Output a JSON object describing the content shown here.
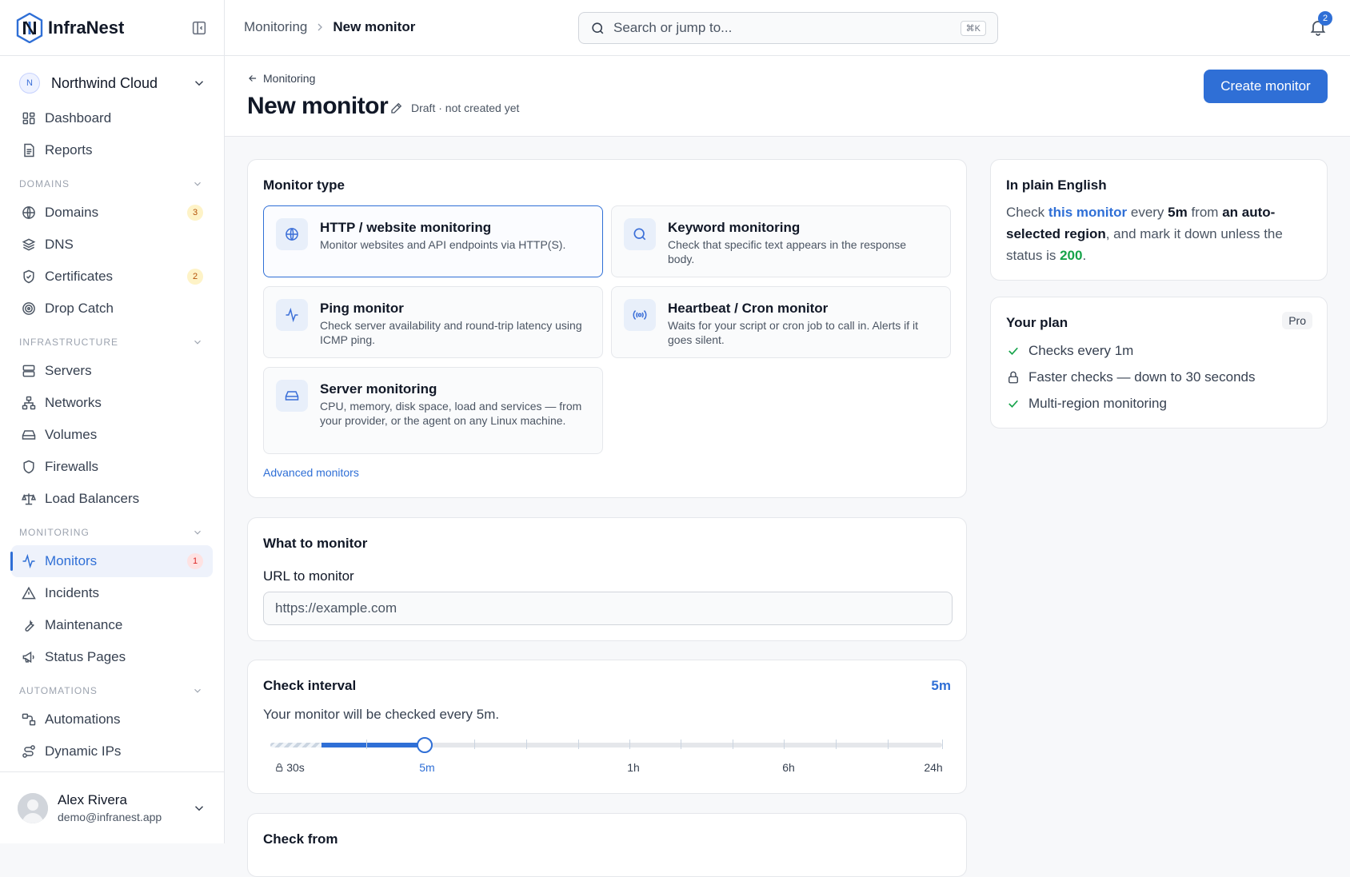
{
  "app": {
    "name": "InfraNest"
  },
  "org": {
    "initial": "N",
    "name": "Northwind Cloud"
  },
  "nav": {
    "top": [
      {
        "label": "Dashboard",
        "icon": "dashboard-icon"
      },
      {
        "label": "Reports",
        "icon": "document-icon"
      }
    ],
    "sections": [
      {
        "title": "DOMAINS",
        "items": [
          {
            "label": "Domains",
            "icon": "globe-icon",
            "badge": "3"
          },
          {
            "label": "DNS",
            "icon": "layers-icon"
          },
          {
            "label": "Certificates",
            "icon": "shield-check-icon",
            "badge": "2"
          },
          {
            "label": "Drop Catch",
            "icon": "target-icon"
          }
        ]
      },
      {
        "title": "INFRASTRUCTURE",
        "items": [
          {
            "label": "Servers",
            "icon": "server-icon"
          },
          {
            "label": "Networks",
            "icon": "network-icon"
          },
          {
            "label": "Volumes",
            "icon": "drive-icon"
          },
          {
            "label": "Firewalls",
            "icon": "shield-icon"
          },
          {
            "label": "Load Balancers",
            "icon": "scale-icon"
          }
        ]
      },
      {
        "title": "MONITORING",
        "items": [
          {
            "label": "Monitors",
            "icon": "activity-icon",
            "badge": "1",
            "active": true
          },
          {
            "label": "Incidents",
            "icon": "warning-icon"
          },
          {
            "label": "Maintenance",
            "icon": "wrench-icon"
          },
          {
            "label": "Status Pages",
            "icon": "megaphone-icon"
          }
        ]
      },
      {
        "title": "AUTOMATIONS",
        "items": [
          {
            "label": "Automations",
            "icon": "workflow-icon"
          },
          {
            "label": "Dynamic IPs",
            "icon": "route-icon"
          }
        ]
      }
    ]
  },
  "user": {
    "name": "Alex Rivera",
    "email": "demo@infranest.app"
  },
  "topbar": {
    "breadcrumb": {
      "parent": "Monitoring",
      "current": "New monitor"
    },
    "search_placeholder": "Search or jump to...",
    "search_shortcut": "⌘K",
    "notifications_count": "2"
  },
  "page": {
    "back_label": "Monitoring",
    "title": "New monitor",
    "status": "Draft · not created yet",
    "create_button": "Create monitor"
  },
  "monitor_type": {
    "title": "Monitor type",
    "options": [
      {
        "title": "HTTP / website monitoring",
        "desc": "Monitor websites and API endpoints via HTTP(S).",
        "icon": "globe-icon",
        "selected": true
      },
      {
        "title": "Keyword monitoring",
        "desc": "Check that specific text appears in the response body.",
        "icon": "search-icon"
      },
      {
        "title": "Ping monitor",
        "desc": "Check server availability and round-trip latency using ICMP ping.",
        "icon": "pulse-icon"
      },
      {
        "title": "Heartbeat / Cron monitor",
        "desc": "Waits for your script or cron job to call in. Alerts if it goes silent.",
        "icon": "broadcast-icon"
      },
      {
        "title": "Server monitoring",
        "desc": "CPU, memory, disk space, load and services — from your provider, or the agent on any Linux machine.",
        "icon": "hard-drive-icon"
      }
    ],
    "advanced_link": "Advanced monitors"
  },
  "what": {
    "title": "What to monitor",
    "url_label": "URL to monitor",
    "url_placeholder": "https://example.com"
  },
  "interval": {
    "title": "Check interval",
    "value": "5m",
    "subtitle": "Your monitor will be checked every 5m.",
    "labels": {
      "min": "30s",
      "current": "5m",
      "l1h": "1h",
      "l6h": "6h",
      "max": "24h"
    },
    "locked_label": "30s"
  },
  "check_from": {
    "title": "Check from"
  },
  "plain_english": {
    "title": "In plain English",
    "p1": "Check ",
    "link": "this monitor",
    "p2": " every ",
    "interval": "5m",
    "p3": " from ",
    "region": "an auto-selected region",
    "p4": ", and mark it down unless the status is ",
    "status": "200",
    "p5": "."
  },
  "plan": {
    "title": "Your plan",
    "tier": "Pro",
    "features": [
      {
        "label": "Checks every 1m",
        "icon": "check-icon"
      },
      {
        "label": "Faster checks — down to 30 seconds",
        "icon": "lock-icon"
      },
      {
        "label": "Multi-region monitoring",
        "icon": "check-icon"
      }
    ]
  },
  "colors": {
    "accent": "#2f6fd6",
    "success": "#16a34a",
    "amber": "#b45309",
    "danger": "#dc2626"
  }
}
